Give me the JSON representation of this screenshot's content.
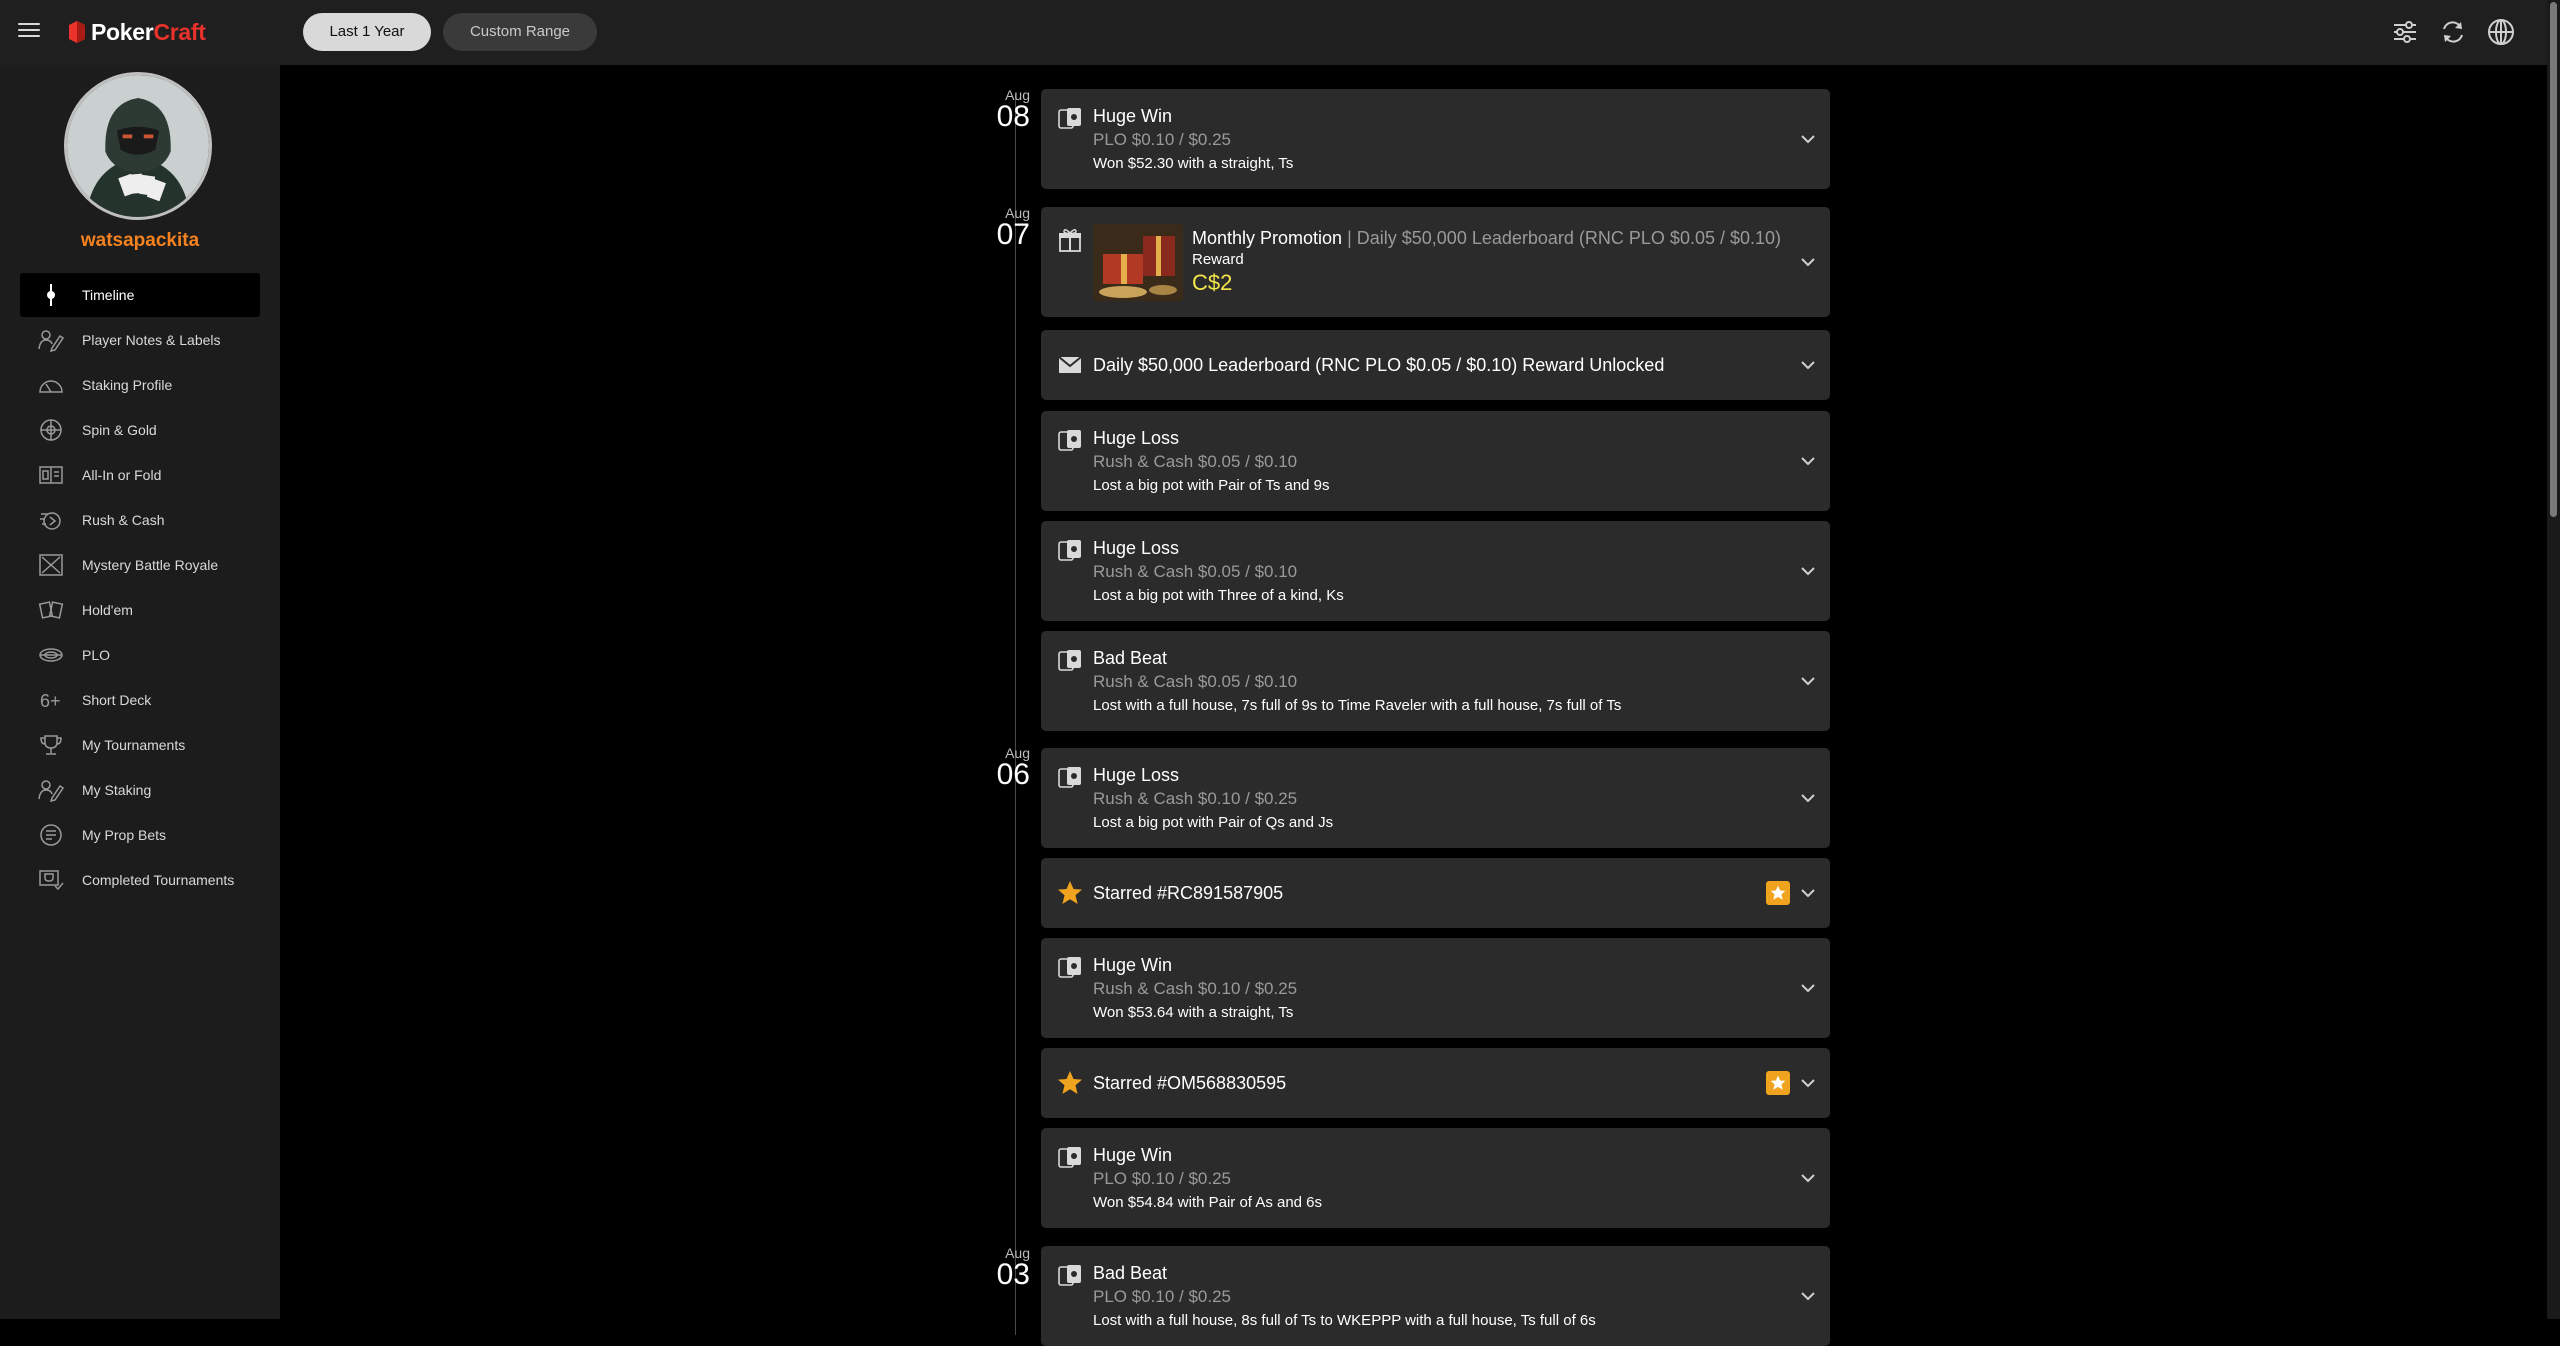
{
  "header": {
    "logo": {
      "poker": "Poker",
      "craft": "Craft"
    },
    "range_active": "Last 1 Year",
    "range_custom": "Custom Range",
    "icons": [
      "filter-icon",
      "refresh-icon",
      "globe-icon"
    ]
  },
  "sidebar": {
    "username": "watsapackita",
    "items": [
      {
        "label": "Timeline",
        "icon": "timeline-icon",
        "active": true
      },
      {
        "label": "Player Notes & Labels",
        "icon": "notes-icon"
      },
      {
        "label": "Staking Profile",
        "icon": "gauge-icon"
      },
      {
        "label": "Spin & Gold",
        "icon": "spin-wheel-icon"
      },
      {
        "label": "All-In or Fold",
        "icon": "allin-icon"
      },
      {
        "label": "Rush & Cash",
        "icon": "rush-icon"
      },
      {
        "label": "Mystery Battle Royale",
        "icon": "swords-icon"
      },
      {
        "label": "Hold'em",
        "icon": "holdem-cards-icon"
      },
      {
        "label": "PLO",
        "icon": "plo-cards-icon"
      },
      {
        "label": "Short Deck",
        "icon": "six-plus-icon"
      },
      {
        "label": "My Tournaments",
        "icon": "trophy-icon"
      },
      {
        "label": "My Staking",
        "icon": "staking-icon"
      },
      {
        "label": "My Prop Bets",
        "icon": "prop-bets-icon"
      },
      {
        "label": "Completed Tournaments",
        "icon": "completed-trophy-icon"
      }
    ]
  },
  "timeline": {
    "dates": [
      {
        "mon": "Aug",
        "day": "08"
      },
      {
        "mon": "Aug",
        "day": "07"
      },
      {
        "mon": "Aug",
        "day": "06"
      },
      {
        "mon": "Aug",
        "day": "03"
      }
    ],
    "cards": [
      {
        "type": "hand",
        "title": "Huge Win",
        "sub": "PLO $0.10 / $0.25",
        "desc": "Won $52.30 with a straight, Ts"
      },
      {
        "type": "promo",
        "title": "Monthly Promotion",
        "sep": " | Daily $50,000 Leaderboard (RNC PLO $0.05 / $0.10)",
        "reward_label": "Reward",
        "reward": "C$2"
      },
      {
        "type": "message",
        "title": "Daily $50,000 Leaderboard (RNC PLO $0.05 / $0.10) Reward Unlocked"
      },
      {
        "type": "hand",
        "title": "Huge Loss",
        "sub": "Rush & Cash $0.05 / $0.10",
        "desc": "Lost a big pot with Pair of Ts and 9s"
      },
      {
        "type": "hand",
        "title": "Huge Loss",
        "sub": "Rush & Cash $0.05 / $0.10",
        "desc": "Lost a big pot with Three of a kind, Ks"
      },
      {
        "type": "hand",
        "title": "Bad Beat",
        "sub": "Rush & Cash $0.05 / $0.10",
        "desc": "Lost with a full house, 7s full of 9s to Time Raveler with a full house, 7s full of Ts"
      },
      {
        "type": "hand",
        "title": "Huge Loss",
        "sub": "Rush & Cash $0.10 / $0.25",
        "desc": "Lost a big pot with Pair of Qs and Js"
      },
      {
        "type": "star",
        "title": "Starred #RC891587905"
      },
      {
        "type": "hand",
        "title": "Huge Win",
        "sub": "Rush & Cash $0.10 / $0.25",
        "desc": "Won $53.64 with a straight, Ts"
      },
      {
        "type": "star",
        "title": "Starred #OM568830595"
      },
      {
        "type": "hand",
        "title": "Huge Win",
        "sub": "PLO $0.10 / $0.25",
        "desc": "Won $54.84 with Pair of As and 6s"
      },
      {
        "type": "hand",
        "title": "Bad Beat",
        "sub": "PLO $0.10 / $0.25",
        "desc": "Lost with a full house, 8s full of Ts to WKEPPP with a full house, Ts full of 6s"
      }
    ]
  },
  "colors": {
    "brand_orange": "#f5821f",
    "logo_red": "#e8322a",
    "reward_yellow": "#f3e54a",
    "star": "#f0a31e"
  }
}
